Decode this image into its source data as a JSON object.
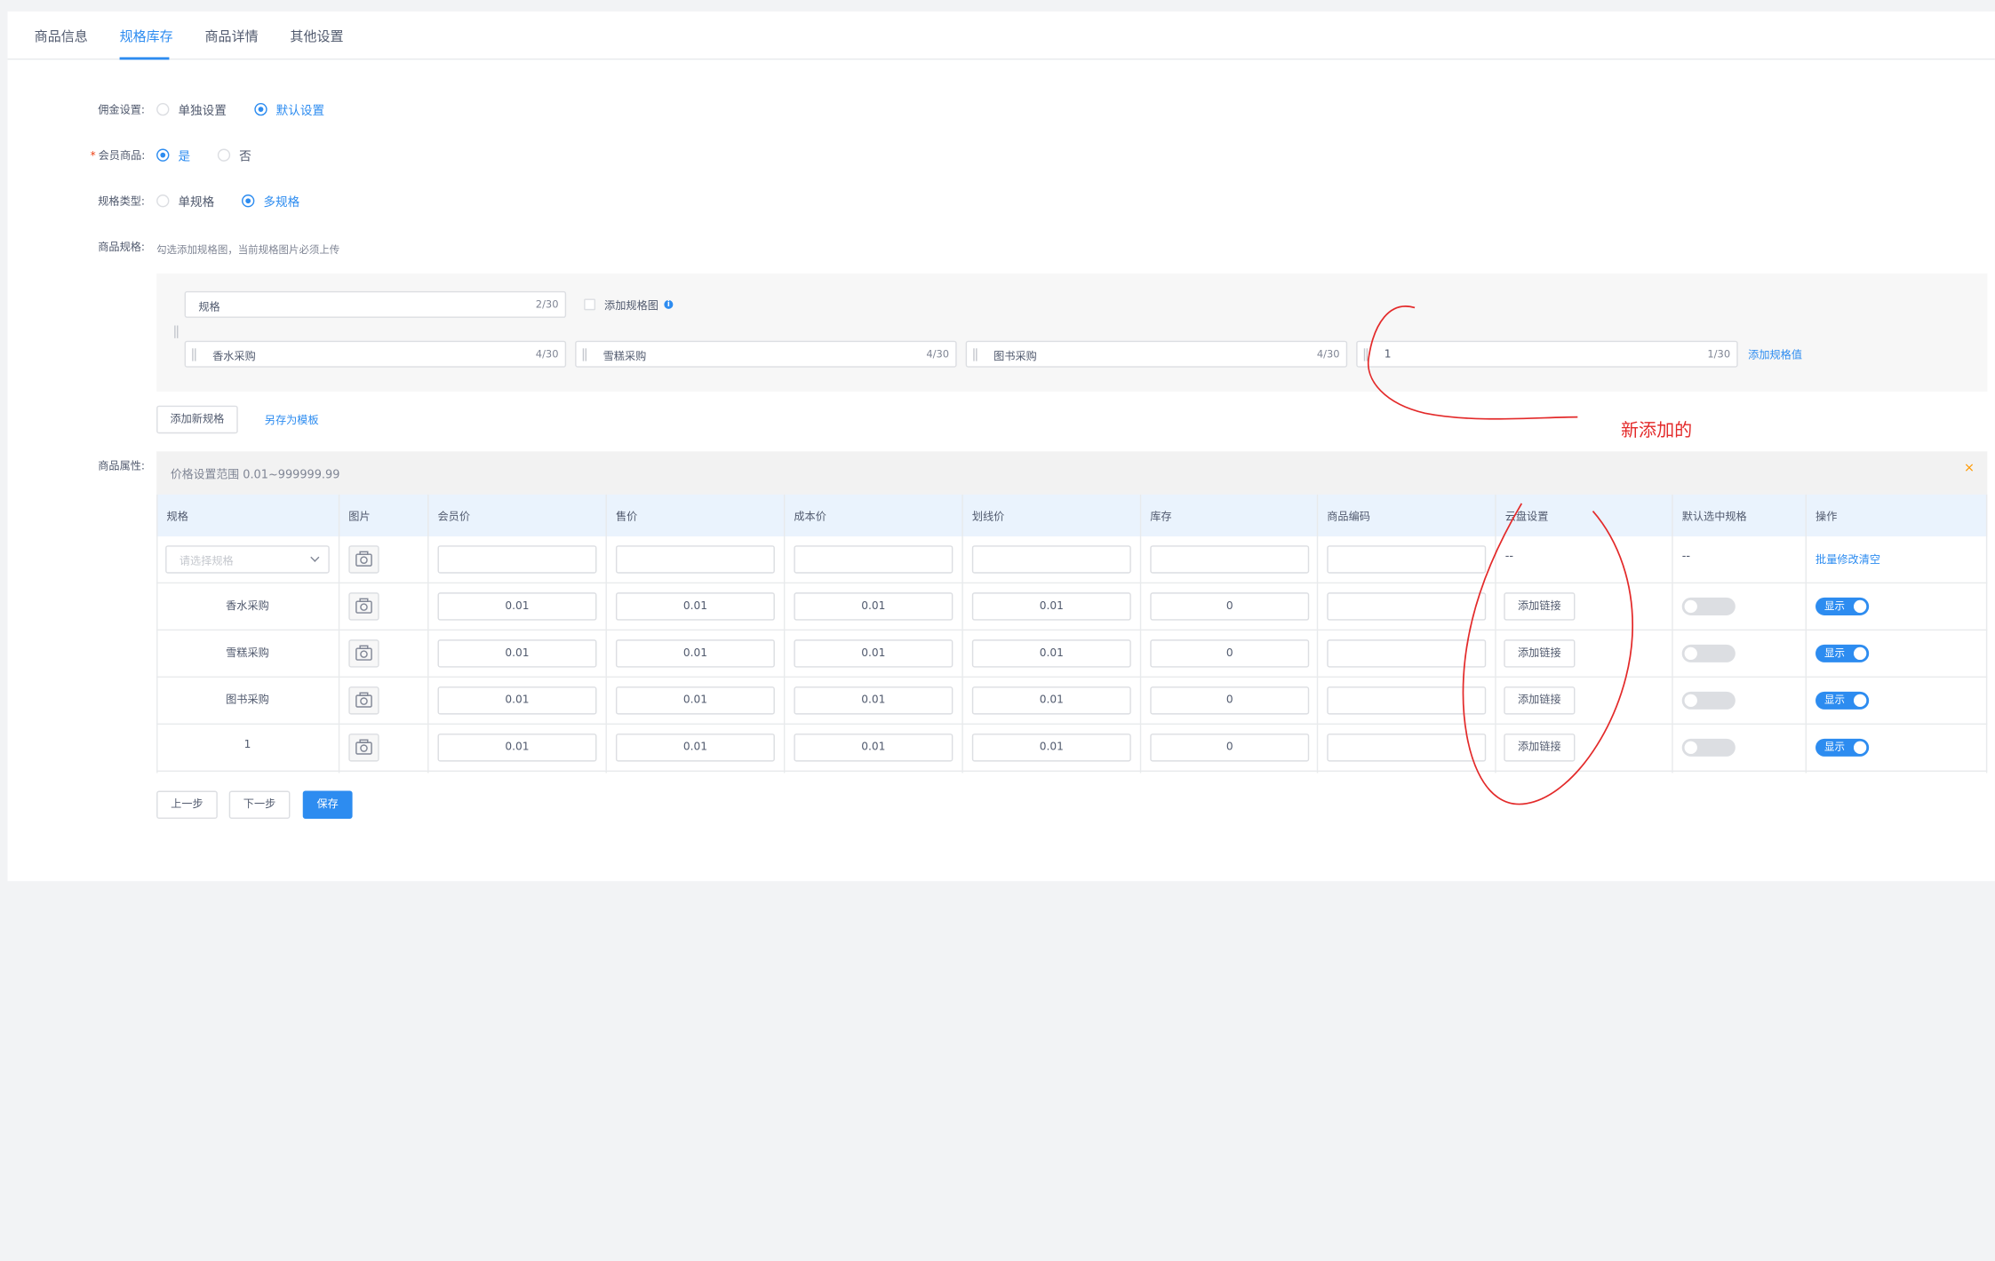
{
  "tabs": [
    {
      "label": "商品信息"
    },
    {
      "label": "规格库存"
    },
    {
      "label": "商品详情"
    },
    {
      "label": "其他设置"
    }
  ],
  "form": {
    "commission": {
      "label": "佣金设置:",
      "options": [
        "单独设置",
        "默认设置"
      ],
      "selected": "默认设置"
    },
    "member": {
      "required_mark": "*",
      "label": "会员商品:",
      "options": [
        "是",
        "否"
      ],
      "selected": "是"
    },
    "spec_type": {
      "label": "规格类型:",
      "options": [
        "单规格",
        "多规格"
      ],
      "selected": "多规格"
    },
    "spec": {
      "label": "商品规格:",
      "hint": "勾选添加规格图，当前规格图片必须上传"
    }
  },
  "spec_editor": {
    "name_input": {
      "value": "规格",
      "count": "2/30"
    },
    "add_image_label": "添加规格图",
    "info_icon": "i",
    "values": [
      {
        "value": "香水采购",
        "count": "4/30"
      },
      {
        "value": "雪糕采购",
        "count": "4/30"
      },
      {
        "value": "图书采购",
        "count": "4/30"
      },
      {
        "value": "1",
        "count": "1/30"
      }
    ],
    "add_value_link": "添加规格值",
    "add_spec_button": "添加新规格",
    "save_template_link": "另存为模板"
  },
  "attributes": {
    "label": "商品属性:",
    "notice": "价格设置范围 0.01~999999.99",
    "notice_close": "×",
    "columns": [
      "规格",
      "图片",
      "会员价",
      "售价",
      "成本价",
      "划线价",
      "库存",
      "商品编码",
      "云盘设置",
      "默认选中规格",
      "操作"
    ],
    "batch_row": {
      "select_placeholder": "请选择规格",
      "cloud": "--",
      "default": "--",
      "action": "批量修改清空"
    },
    "rows": [
      {
        "name": "香水采购",
        "member_price": "0.01",
        "price": "0.01",
        "cost": "0.01",
        "line_price": "0.01",
        "stock": "0",
        "code": "",
        "cloud_button": "添加链接",
        "show_label": "显示"
      },
      {
        "name": "雪糕采购",
        "member_price": "0.01",
        "price": "0.01",
        "cost": "0.01",
        "line_price": "0.01",
        "stock": "0",
        "code": "",
        "cloud_button": "添加链接",
        "show_label": "显示"
      },
      {
        "name": "图书采购",
        "member_price": "0.01",
        "price": "0.01",
        "cost": "0.01",
        "line_price": "0.01",
        "stock": "0",
        "code": "",
        "cloud_button": "添加链接",
        "show_label": "显示"
      },
      {
        "name": "1",
        "member_price": "0.01",
        "price": "0.01",
        "cost": "0.01",
        "line_price": "0.01",
        "stock": "0",
        "code": "",
        "cloud_button": "添加链接",
        "show_label": "显示"
      }
    ]
  },
  "footer": {
    "prev": "上一步",
    "next": "下一步",
    "save": "保存"
  },
  "annotation": {
    "text": "新添加的",
    "color": "#e32a2a"
  },
  "colors": {
    "accent": "#2d8cf0",
    "warning": "#ff9900"
  }
}
